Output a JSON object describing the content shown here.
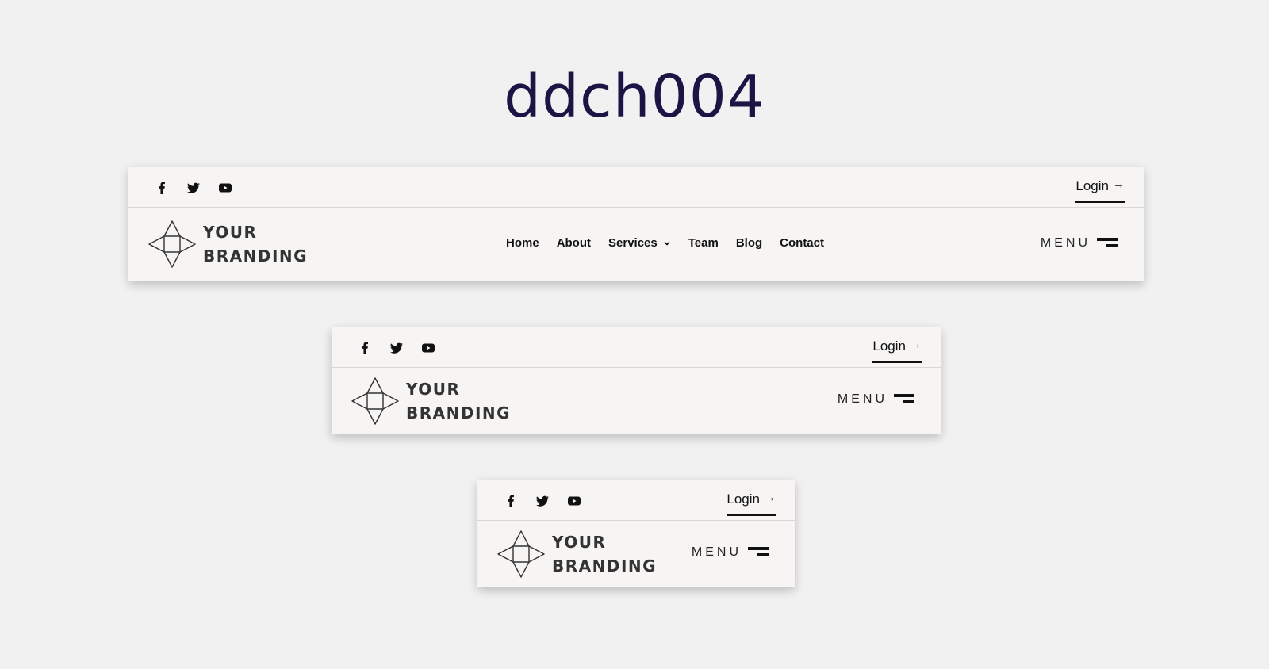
{
  "page": {
    "title": "ddch004"
  },
  "colors": {
    "background": "#f1f1f1",
    "header_bg": "#f7f5f4",
    "title": "#1c1444",
    "text": "#111111",
    "brand_text": "#333333"
  },
  "headers": [
    {
      "variant": "desktop",
      "social": [
        "facebook-icon",
        "twitter-icon",
        "youtube-icon"
      ],
      "login": {
        "label": "Login",
        "arrow": "→"
      },
      "brand": {
        "line1": "YOUR",
        "line2": "BRANDING"
      },
      "nav": {
        "home": "Home",
        "about": "About",
        "services": "Services",
        "team": "Team",
        "blog": "Blog",
        "contact": "Contact"
      },
      "menu_label": "MENU"
    },
    {
      "variant": "tablet",
      "social": [
        "facebook-icon",
        "twitter-icon",
        "youtube-icon"
      ],
      "login": {
        "label": "Login",
        "arrow": "→"
      },
      "brand": {
        "line1": "YOUR",
        "line2": "BRANDING"
      },
      "menu_label": "MENU"
    },
    {
      "variant": "mobile",
      "social": [
        "facebook-icon",
        "twitter-icon",
        "youtube-icon"
      ],
      "login": {
        "label": "Login",
        "arrow": "→"
      },
      "brand": {
        "line1": "YOUR",
        "line2": "BRANDING"
      },
      "menu_label": "MENU"
    }
  ]
}
